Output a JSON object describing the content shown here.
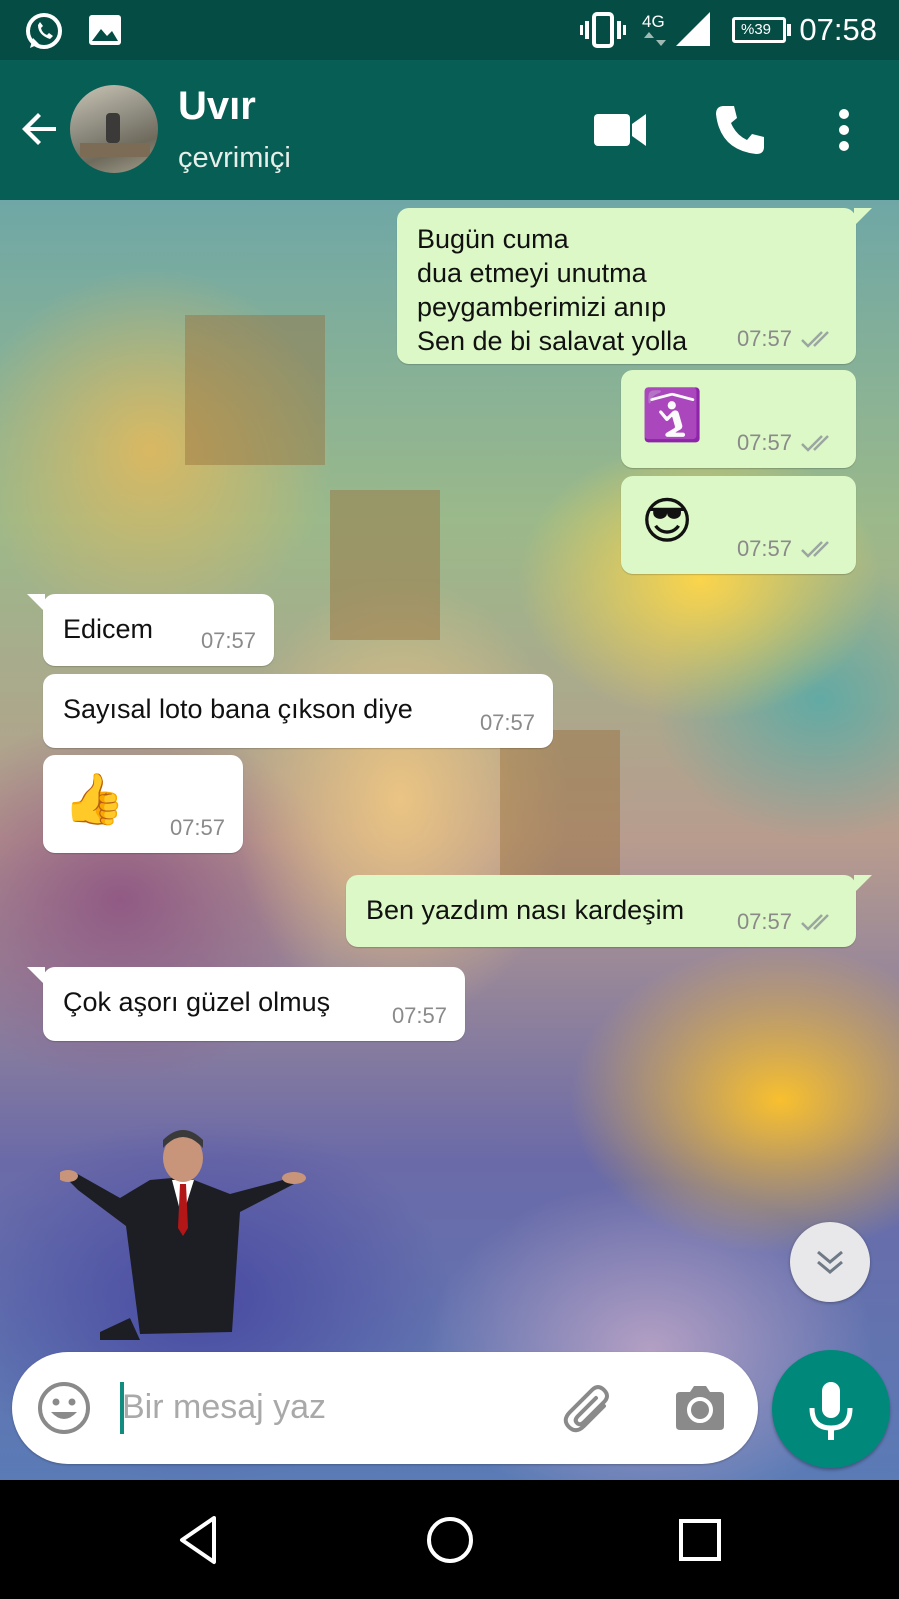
{
  "status_bar": {
    "network": "4G",
    "battery": "%39",
    "time": "07:58"
  },
  "header": {
    "contact_name": "Uvır",
    "contact_status": "çevrimiçi"
  },
  "messages": [
    {
      "direction": "out",
      "text": "Bugün cuma\ndua etmeyi unutma\npeygamberimizi anıp\nSen de bi salavat yolla",
      "time": "07:57",
      "read": true
    },
    {
      "direction": "out",
      "emoji": "🛐",
      "time": "07:57",
      "read": true
    },
    {
      "direction": "out",
      "emoji": "😎",
      "time": "07:57",
      "read": true
    },
    {
      "direction": "in",
      "text": "Edicem",
      "time": "07:57"
    },
    {
      "direction": "in",
      "text": "Sayısal loto bana çıkson diye",
      "time": "07:57"
    },
    {
      "direction": "in",
      "emoji": "👍",
      "time": "07:57"
    },
    {
      "direction": "out",
      "text": "Ben yazdım nası kardeşim",
      "time": "07:57",
      "read": true
    },
    {
      "direction": "in",
      "text": "Çok aşorı güzel olmuş",
      "time": "07:57"
    }
  ],
  "input": {
    "placeholder": "Bir mesaj yaz"
  },
  "colors": {
    "header": "#075e54",
    "status_bar": "#054d44",
    "outgoing_bubble": "#dcf8c6",
    "incoming_bubble": "#ffffff",
    "read_ticks": "#9aa6a0",
    "mic_button": "#00897b"
  },
  "icons": [
    "whatsapp-icon",
    "gallery-icon",
    "vibrate-icon",
    "signal-icon",
    "battery-icon",
    "back-arrow-icon",
    "video-call-icon",
    "phone-icon",
    "more-vert-icon",
    "double-check-icon",
    "chevron-double-down-icon",
    "emoji-icon",
    "attach-icon",
    "camera-icon",
    "mic-icon",
    "nav-back-icon",
    "nav-home-icon",
    "nav-recents-icon"
  ]
}
